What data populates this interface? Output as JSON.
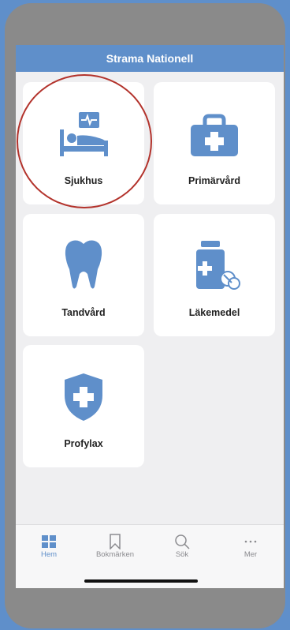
{
  "header": {
    "title": "Strama Nationell"
  },
  "cards": [
    {
      "label": "Sjukhus"
    },
    {
      "label": "Primärvård"
    },
    {
      "label": "Tandvård"
    },
    {
      "label": "Läkemedel"
    },
    {
      "label": "Profylax"
    }
  ],
  "tabs": [
    {
      "label": "Hem",
      "icon": "grid-icon",
      "active": true
    },
    {
      "label": "Bokmärken",
      "icon": "bookmark-icon"
    },
    {
      "label": "Sök",
      "icon": "search-icon"
    },
    {
      "label": "Mer",
      "icon": "more-icon"
    }
  ],
  "colors": {
    "accent": "#5f8fca",
    "highlight_circle": "#b3332c",
    "background": "#efeff1"
  }
}
